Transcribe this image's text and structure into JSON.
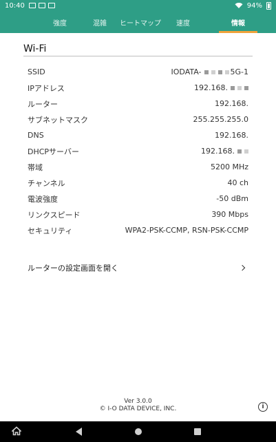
{
  "status": {
    "time": "10:40",
    "battery": "94%"
  },
  "tabs": [
    {
      "label": "強度"
    },
    {
      "label": "混雑"
    },
    {
      "label": "ヒートマップ"
    },
    {
      "label": "速度"
    },
    {
      "label": "情報"
    }
  ],
  "section": {
    "title": "Wi-Fi"
  },
  "rows": [
    {
      "label": "SSID",
      "value": "IODATA-",
      "suffix": "5G-1"
    },
    {
      "label": "IPアドレス",
      "value": "192.168."
    },
    {
      "label": "ルーター",
      "value": "192.168."
    },
    {
      "label": "サブネットマスク",
      "value": "255.255.255.0"
    },
    {
      "label": "DNS",
      "value": "192.168."
    },
    {
      "label": "DHCPサーバー",
      "value": "192.168."
    },
    {
      "label": "帯域",
      "value": "5200 MHz"
    },
    {
      "label": "チャンネル",
      "value": "40 ch"
    },
    {
      "label": "電波強度",
      "value": "-50 dBm"
    },
    {
      "label": "リンクスピード",
      "value": "390 Mbps"
    },
    {
      "label": "セキュリティ",
      "value": "WPA2-PSK-CCMP, RSN-PSK-CCMP"
    }
  ],
  "router_link": {
    "label": "ルーターの設定画面を開く"
  },
  "footer": {
    "version": "Ver 3.0.0",
    "copyright": "© I-O DATA DEVICE, INC."
  },
  "info_button": {
    "glyph": "i"
  }
}
